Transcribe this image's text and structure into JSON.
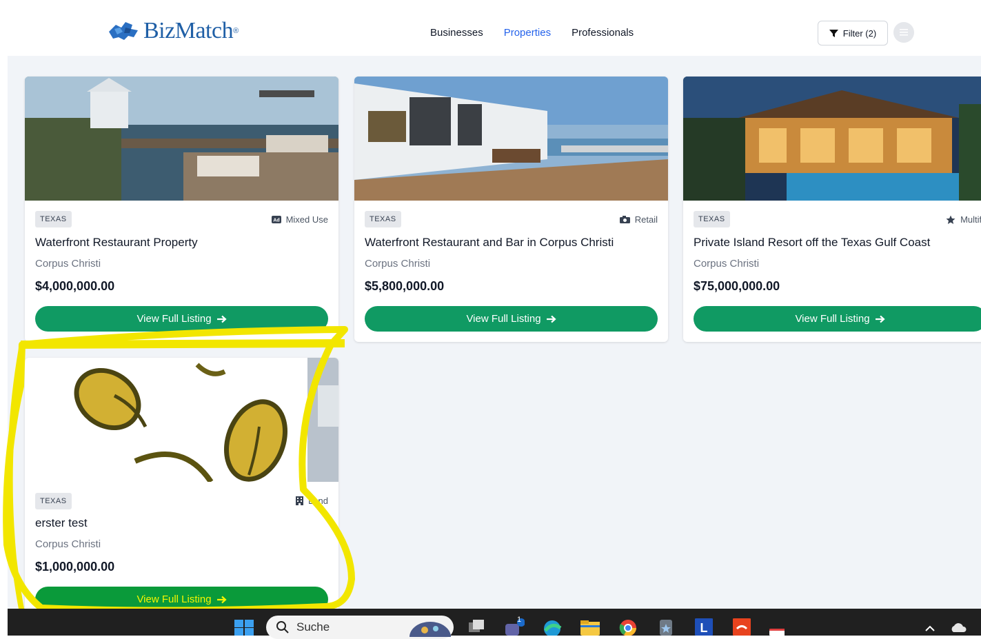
{
  "header": {
    "logo_text": "BizMatch",
    "logo_reg": "®",
    "nav": [
      {
        "label": "Businesses",
        "active": false
      },
      {
        "label": "Properties",
        "active": true
      },
      {
        "label": "Professionals",
        "active": false
      }
    ],
    "filter_label": "Filter (2)"
  },
  "listings": [
    {
      "state": "TEXAS",
      "type_icon": "ad-icon",
      "type": "Mixed Use",
      "title": "Waterfront Restaurant Property",
      "city": "Corpus Christi",
      "price": "$4,000,000.00",
      "button": "View Full Listing"
    },
    {
      "state": "TEXAS",
      "type_icon": "camera-icon",
      "type": "Retail",
      "title": "Waterfront Restaurant and Bar in Corpus Christi",
      "city": "Corpus Christi",
      "price": "$5,800,000.00",
      "button": "View Full Listing"
    },
    {
      "state": "TEXAS",
      "type_icon": "star-icon",
      "type": "Multifamil",
      "title": "Private Island Resort off the Texas Gulf Coast",
      "city": "Corpus Christi",
      "price": "$75,000,000.00",
      "button": "View Full Listing"
    },
    {
      "state": "TEXAS",
      "type_icon": "building-icon",
      "type": "Land",
      "title": "erster test",
      "city": "Corpus Christi",
      "price": "$1,000,000.00",
      "button": "View Full Listing"
    }
  ],
  "taskbar": {
    "search_label": "Suche",
    "notification_count": "1"
  },
  "colors": {
    "accent_green": "#109a63",
    "nav_active": "#2563eb",
    "highlight": "#f5e800"
  }
}
